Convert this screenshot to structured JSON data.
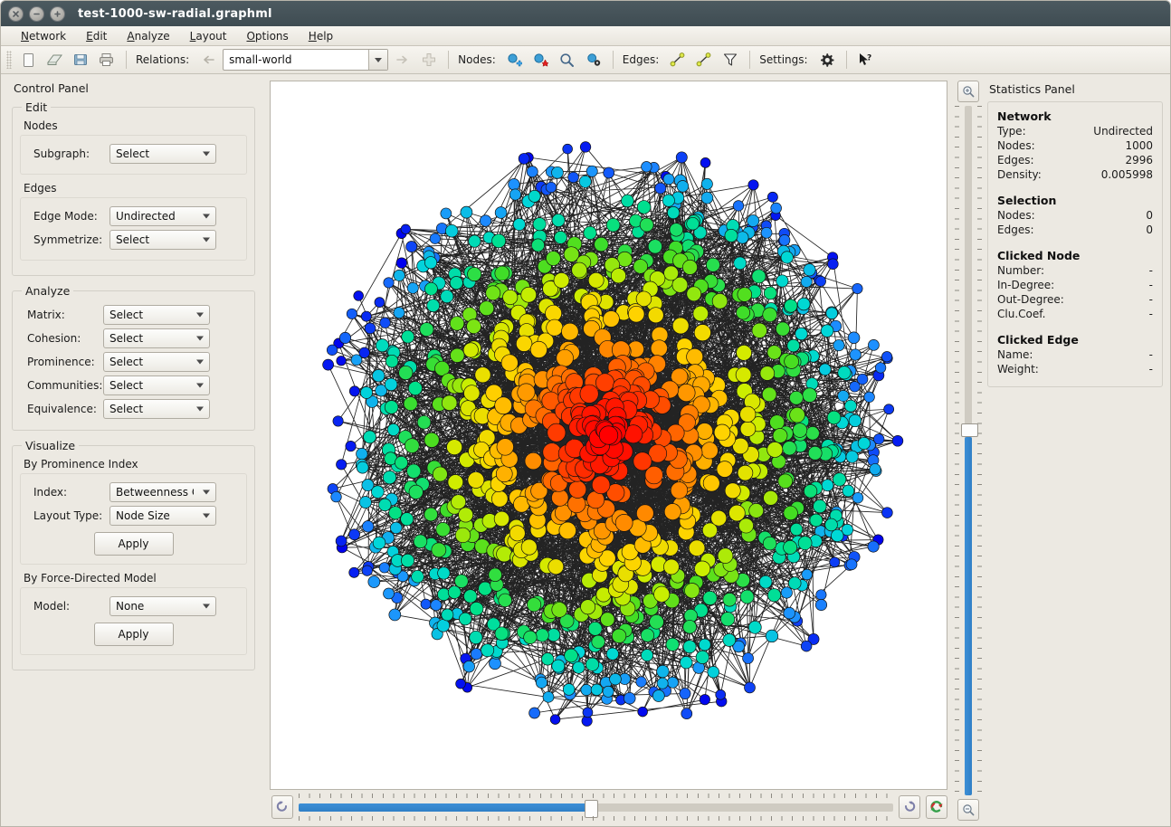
{
  "window": {
    "title": "test-1000-sw-radial.graphml",
    "buttons": [
      {
        "name": "close-window-button",
        "glyph": "×"
      },
      {
        "name": "minimize-window-button",
        "glyph": "−"
      },
      {
        "name": "maximize-window-button",
        "glyph": "+"
      }
    ]
  },
  "menubar": {
    "items": [
      {
        "mnemonic": "N",
        "rest": "etwork"
      },
      {
        "mnemonic": "E",
        "rest": "dit"
      },
      {
        "mnemonic": "A",
        "rest": "nalyze"
      },
      {
        "mnemonic": "L",
        "rest": "ayout"
      },
      {
        "mnemonic": "O",
        "rest": "ptions"
      },
      {
        "mnemonic": "H",
        "rest": "elp"
      }
    ]
  },
  "toolbar": {
    "file_icons": [
      "new-document-icon",
      "open-file-icon",
      "save-file-icon",
      "print-icon"
    ],
    "relations_label": "Relations:",
    "relation_value": "small-world",
    "nodes_label": "Nodes:",
    "node_icons": [
      "add-node-icon",
      "remove-node-icon",
      "find-node-icon",
      "node-properties-icon"
    ],
    "edges_label": "Edges:",
    "edge_icons": [
      "add-edge-icon",
      "remove-edge-icon",
      "filter-edges-icon"
    ],
    "settings_label": "Settings:",
    "settings_icons": [
      "gear-icon",
      "help-cursor-icon"
    ]
  },
  "control_panel": {
    "title": "Control Panel",
    "edit": {
      "legend": "Edit",
      "nodes": {
        "legend": "Nodes",
        "rows": [
          {
            "label": "Subgraph:",
            "value": "Select",
            "name": "subgraph-select"
          }
        ]
      },
      "edges": {
        "legend": "Edges",
        "rows": [
          {
            "label": "Edge Mode:",
            "value": "Undirected",
            "name": "edge-mode-select"
          },
          {
            "label": "Symmetrize:",
            "value": "Select",
            "name": "symmetrize-select"
          }
        ]
      }
    },
    "analyze": {
      "legend": "Analyze",
      "rows": [
        {
          "label": "Matrix:",
          "value": "Select",
          "name": "matrix-select"
        },
        {
          "label": "Cohesion:",
          "value": "Select",
          "name": "cohesion-select"
        },
        {
          "label": "Prominence:",
          "value": "Select",
          "name": "prominence-select"
        },
        {
          "label": "Communities:",
          "value": "Select",
          "name": "communities-select"
        },
        {
          "label": "Equivalence:",
          "value": "Select",
          "name": "equivalence-select"
        }
      ]
    },
    "visualize": {
      "legend": "Visualize",
      "by_prominence": {
        "header": "By Prominence Index",
        "rows": [
          {
            "label": "Index:",
            "value": "Betweenness C",
            "name": "prominence-index-select"
          },
          {
            "label": "Layout Type:",
            "value": "Node Size",
            "name": "layout-type-select"
          }
        ],
        "apply": "Apply"
      },
      "by_force": {
        "header": "By Force-Directed Model",
        "rows": [
          {
            "label": "Model:",
            "value": "None",
            "name": "force-model-select"
          }
        ],
        "apply": "Apply"
      }
    }
  },
  "statistics_panel": {
    "title": "Statistics Panel",
    "search_icon": "search-icon",
    "sections": [
      {
        "heading": "Network",
        "rows": [
          {
            "key": "Type:",
            "value": "Undirected"
          },
          {
            "key": "Nodes:",
            "value": "1000"
          },
          {
            "key": "Edges:",
            "value": "2996"
          },
          {
            "key": "Density:",
            "value": "0.005998"
          }
        ]
      },
      {
        "heading": "Selection",
        "rows": [
          {
            "key": "Nodes:",
            "value": "0"
          },
          {
            "key": "Edges:",
            "value": "0"
          }
        ]
      },
      {
        "heading": "Clicked Node",
        "rows": [
          {
            "key": "Number:",
            "value": "-"
          },
          {
            "key": "In-Degree:",
            "value": "-"
          },
          {
            "key": "Out-Degree:",
            "value": "-"
          },
          {
            "key": "Clu.Coef.",
            "value": "-"
          }
        ]
      },
      {
        "heading": "Clicked Edge",
        "rows": [
          {
            "key": "Name:",
            "value": "-"
          },
          {
            "key": "Weight:",
            "value": "-"
          }
        ]
      }
    ]
  },
  "canvas_controls": {
    "zoom_in_icon": "zoom-in-icon",
    "zoom_out_icon": "zoom-out-icon",
    "rotate_left_icon": "rotate-left-icon",
    "rotate_right_icon": "rotate-right-icon",
    "reset_view_icon": "reset-view-icon",
    "zoom_slider_value": 48,
    "rotate_slider_value": 49
  },
  "graph": {
    "layout": "radial",
    "node_count": 1000,
    "edge_count": 2996,
    "color_scale": [
      "#ff0000",
      "#ff7f00",
      "#ffd400",
      "#ccee00",
      "#44dd22",
      "#00e08a",
      "#00d8d8",
      "#1e90ff",
      "#0000ee"
    ],
    "edge_color": "#101010",
    "background": "#ffffff"
  },
  "colors": {
    "chrome": "#ece9e2",
    "titlebar": "#3f4c52",
    "accent": "#2f7fc6",
    "border": "#b7b3a9"
  }
}
